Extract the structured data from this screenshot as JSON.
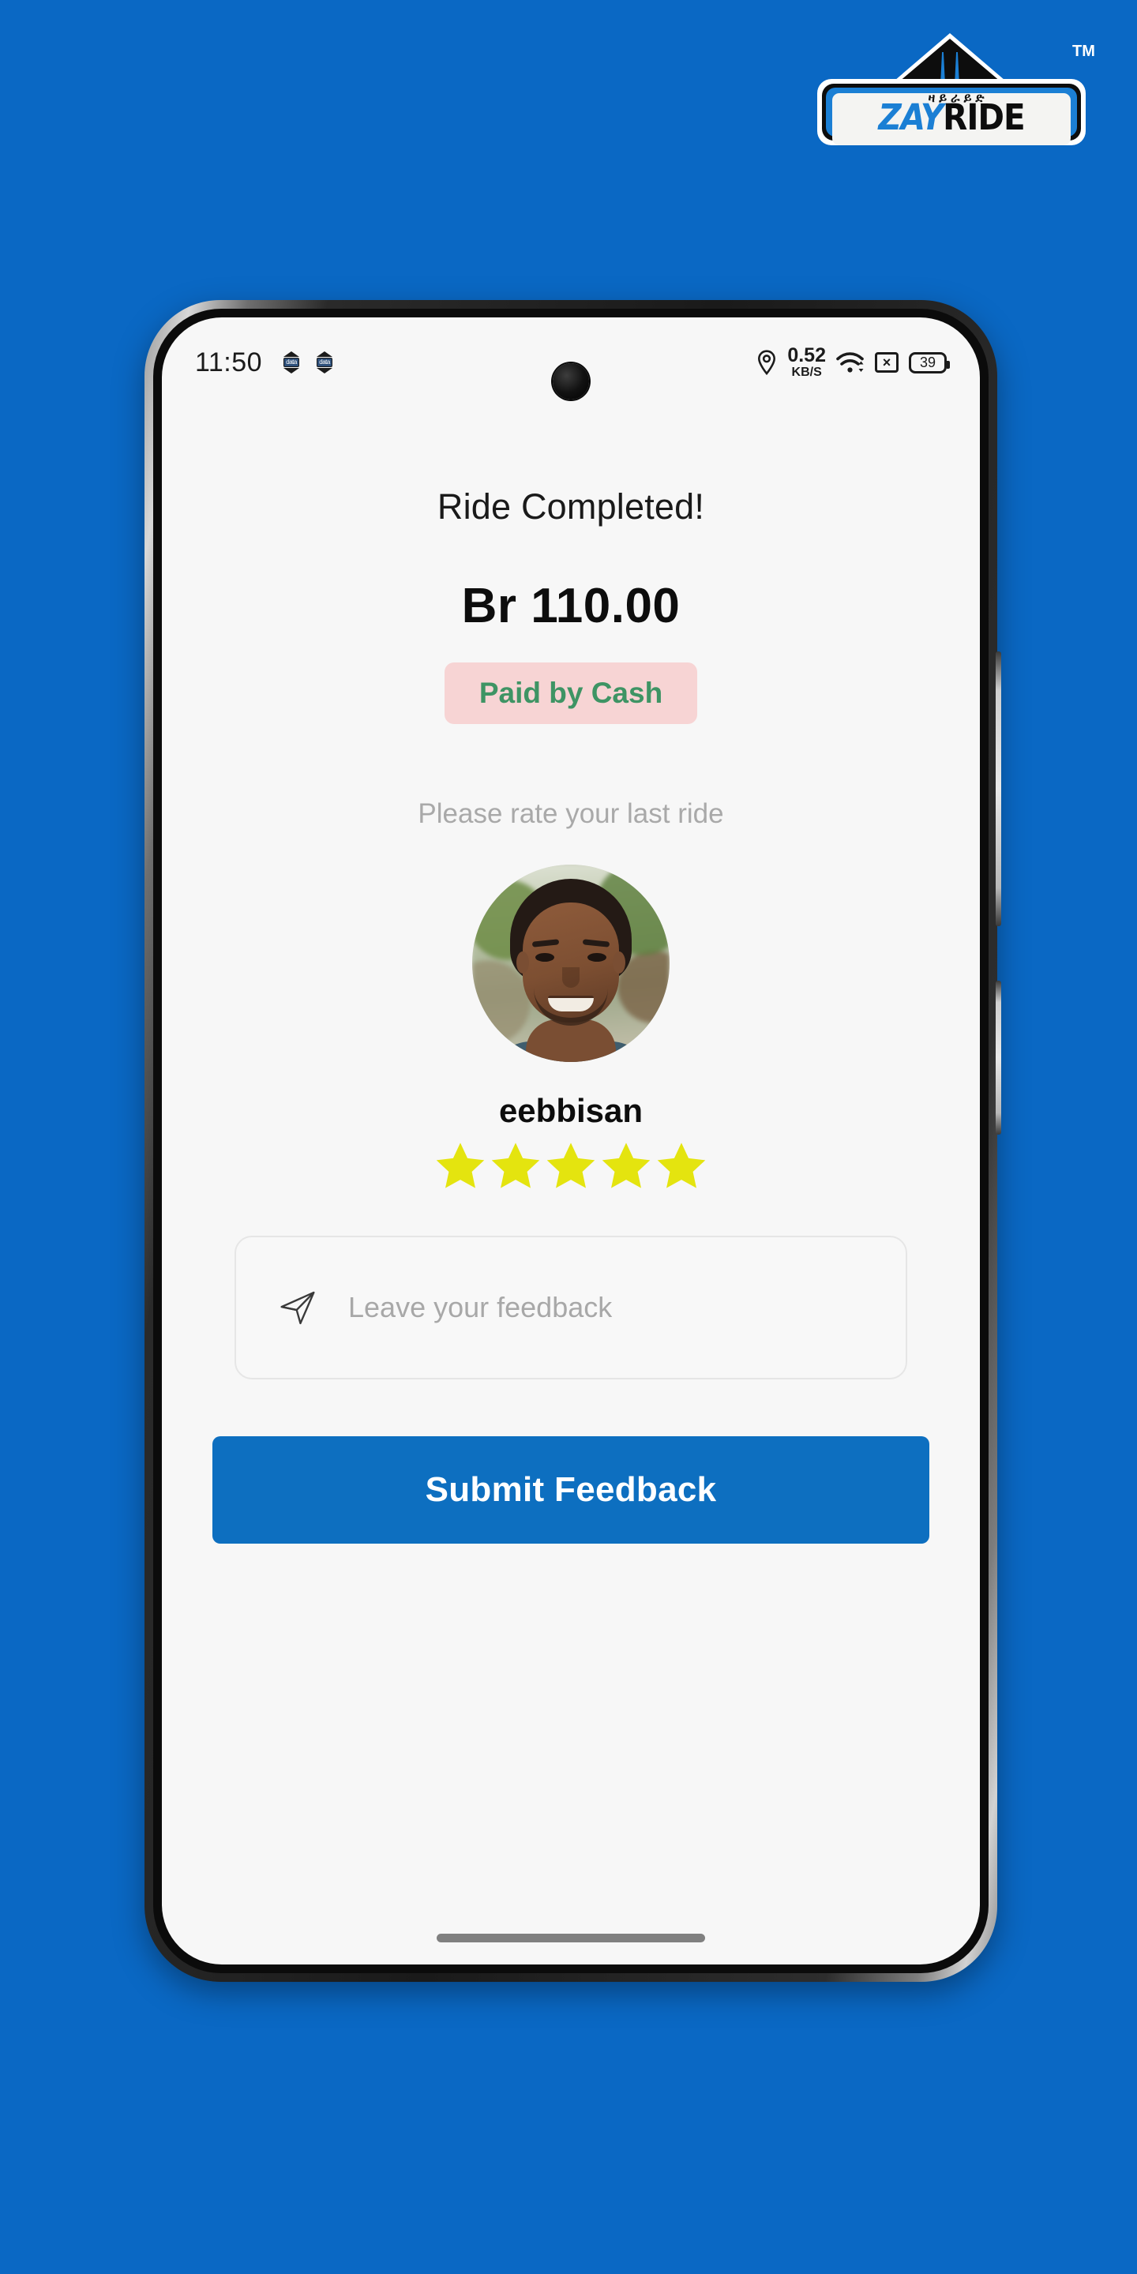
{
  "theme": {
    "page_background": "#0a68c4",
    "brand_blue": "#1b7fd4",
    "button_blue": "#0d6fc0",
    "screen_background": "#f7f7f7",
    "pill_background": "#f7d4d4",
    "pill_text": "#3e9464",
    "star_color": "#e4e40f",
    "muted_text": "#a9a9a9"
  },
  "brand": {
    "name_part_1": "ZAY",
    "name_part_2": "RIDE",
    "amharic": "ዛይራይድ",
    "trademark": "TM",
    "road_icon": "highway-road-icon"
  },
  "status_bar": {
    "time": "11:50",
    "left_icons": [
      {
        "name": "mobile-data-badge-1",
        "label": "data"
      },
      {
        "name": "mobile-data-badge-2",
        "label": "data"
      }
    ],
    "camera": "front-camera-punch-hole",
    "location_icon": "location-pin-icon",
    "network_speed_value": "0.52",
    "network_speed_unit": "KB/S",
    "wifi_icon": "wifi-icon",
    "sim_icon": "sim-card-disabled-icon",
    "battery_level": "39"
  },
  "screen": {
    "title": "Ride Completed!",
    "fare": "Br 110.00",
    "payment_status": "Paid by Cash",
    "rate_prompt": "Please rate your last ride",
    "driver": {
      "avatar": "driver-avatar-photo",
      "name": "eebbisan",
      "rating": 5,
      "max_rating": 5
    },
    "feedback": {
      "icon": "send-paper-plane-icon",
      "value": "",
      "placeholder": "Leave your feedback"
    },
    "submit_label": "Submit Feedback",
    "home_indicator": "home-indicator-bar"
  },
  "hardware": {
    "volume_button": "volume-rocker-button",
    "power_button": "power-button"
  }
}
